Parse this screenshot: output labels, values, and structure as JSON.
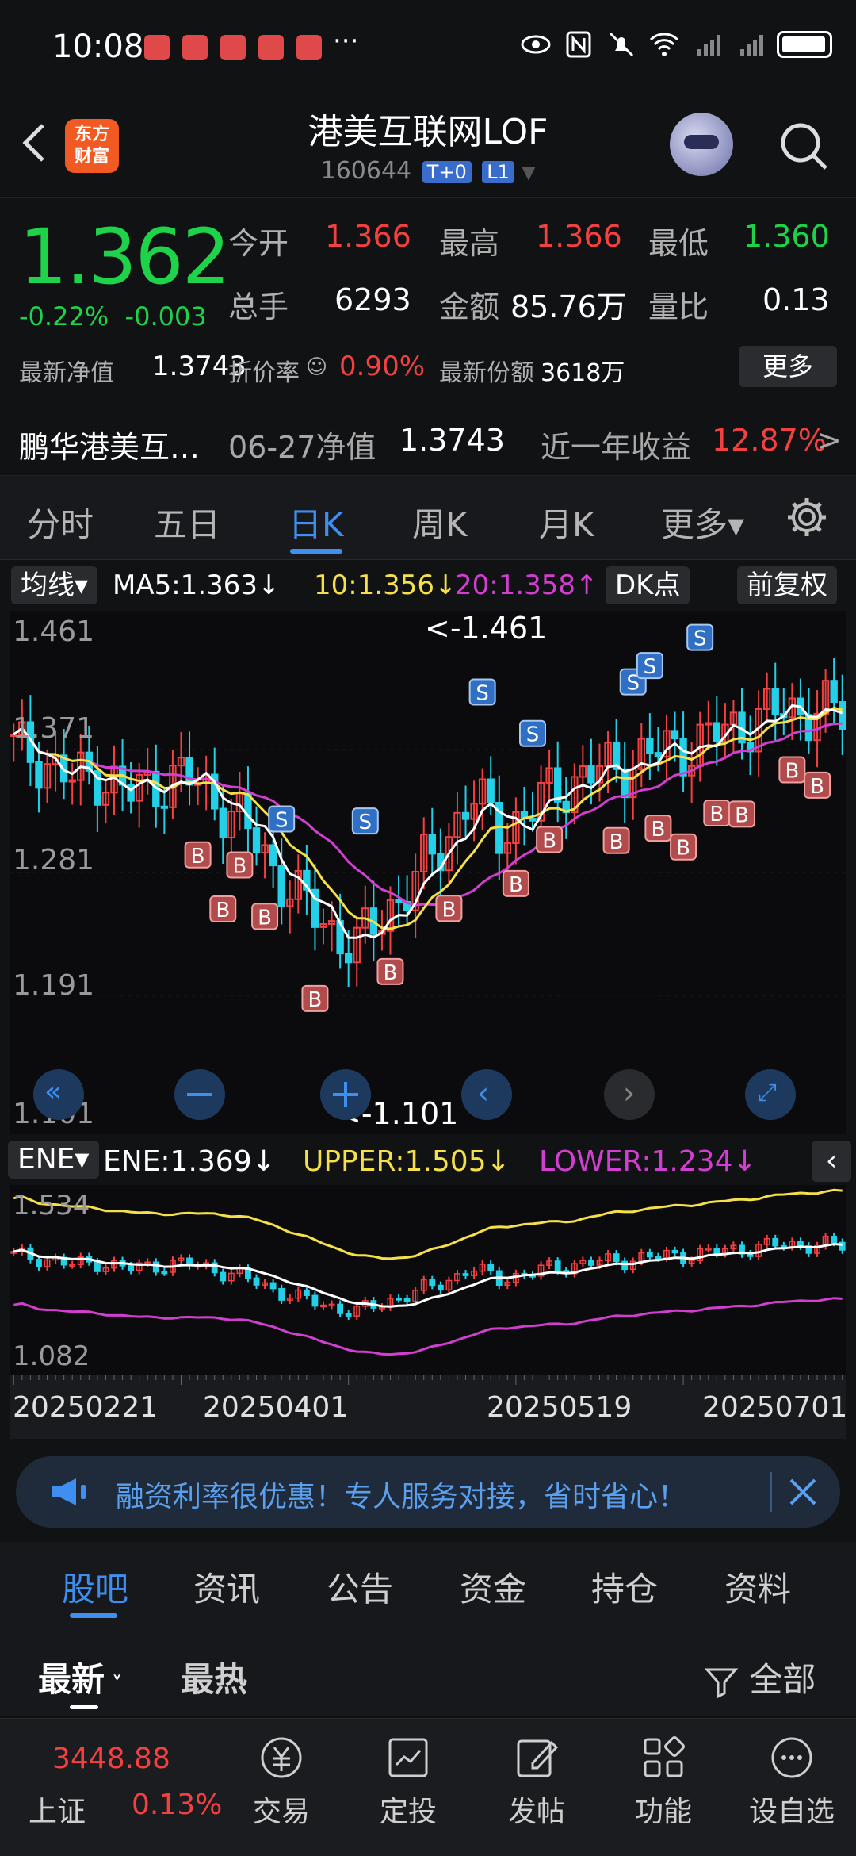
{
  "status": {
    "time": "10:08",
    "dots": "···"
  },
  "header": {
    "title": "港美互联网LOF",
    "code": "160644",
    "tag1": "T+0",
    "tag2": "L1",
    "logo_line1": "东方",
    "logo_line2": "财富"
  },
  "quote": {
    "price": "1.362",
    "change_pct": "-0.22%",
    "change": "-0.003",
    "open_label": "今开",
    "open": "1.366",
    "high_label": "最高",
    "high": "1.366",
    "low_label": "最低",
    "low": "1.360",
    "volume_label": "总手",
    "volume": "6293",
    "amount_label": "金额",
    "amount": "85.76万",
    "ratio_label": "量比",
    "ratio": "0.13",
    "nav_label": "最新净值",
    "nav": "1.3743",
    "discount_label": "折价率",
    "discount": "0.90%",
    "shares_label": "最新份额",
    "shares": "3618万",
    "more": "更多"
  },
  "fund_row": {
    "name": "鹏华港美互…",
    "date_label": "06-27净值",
    "value": "1.3743",
    "return_label": "近一年收益",
    "return": "12.87%",
    "arrow": ">"
  },
  "tabs": [
    "分时",
    "五日",
    "日K",
    "周K",
    "月K",
    "更多▾"
  ],
  "indicators": {
    "selector": "均线▾",
    "ma5": "MA5:1.363↓",
    "ma10": "10:1.356↓",
    "ma20": "20:1.358↑",
    "dk": "DK点",
    "fq": "前复权"
  },
  "chart_main": {
    "y_labels": [
      "1.461",
      "1.371",
      "1.281",
      "1.191",
      "1.101"
    ],
    "high_mark": "<-1.461",
    "low_mark": "<-1.101",
    "marker_b": "B",
    "marker_s": "S"
  },
  "ene": {
    "selector": "ENE▾",
    "ene": "ENE:1.369↓",
    "upper": "UPPER:1.505↓",
    "lower": "LOWER:1.234↓",
    "y_top": "1.534",
    "y_bottom": "1.082"
  },
  "dates": [
    "20250221",
    "20250401",
    "20250519",
    "20250701"
  ],
  "banner": {
    "text": "融资利率很优惠！专人服务对接，省时省心！"
  },
  "subtabs": [
    "股吧",
    "资讯",
    "公告",
    "资金",
    "持仓",
    "资料"
  ],
  "sort": {
    "latest": "最新",
    "hot": "最热",
    "all": "全部"
  },
  "bottom": {
    "index_value": "3448.88",
    "index_name": "上证",
    "index_pct": "0.13%",
    "nav": [
      "交易",
      "定投",
      "发帖",
      "功能",
      "设自选"
    ]
  },
  "colors": {
    "up": "#f34141",
    "down": "#1ed34a",
    "accent": "#3f8ff0",
    "ma5": "#ffffff",
    "ma10": "#f5e04a",
    "ma20": "#d23fd0"
  },
  "chart_data": {
    "type": "candlestick",
    "x": [
      "20250221",
      "20250401",
      "20250519",
      "20250701"
    ],
    "ylim": [
      1.101,
      1.461
    ],
    "series": [
      {
        "name": "MA5",
        "values": [
          1.363
        ]
      },
      {
        "name": "10",
        "values": [
          1.356
        ]
      },
      {
        "name": "20",
        "values": [
          1.358
        ]
      }
    ]
  }
}
